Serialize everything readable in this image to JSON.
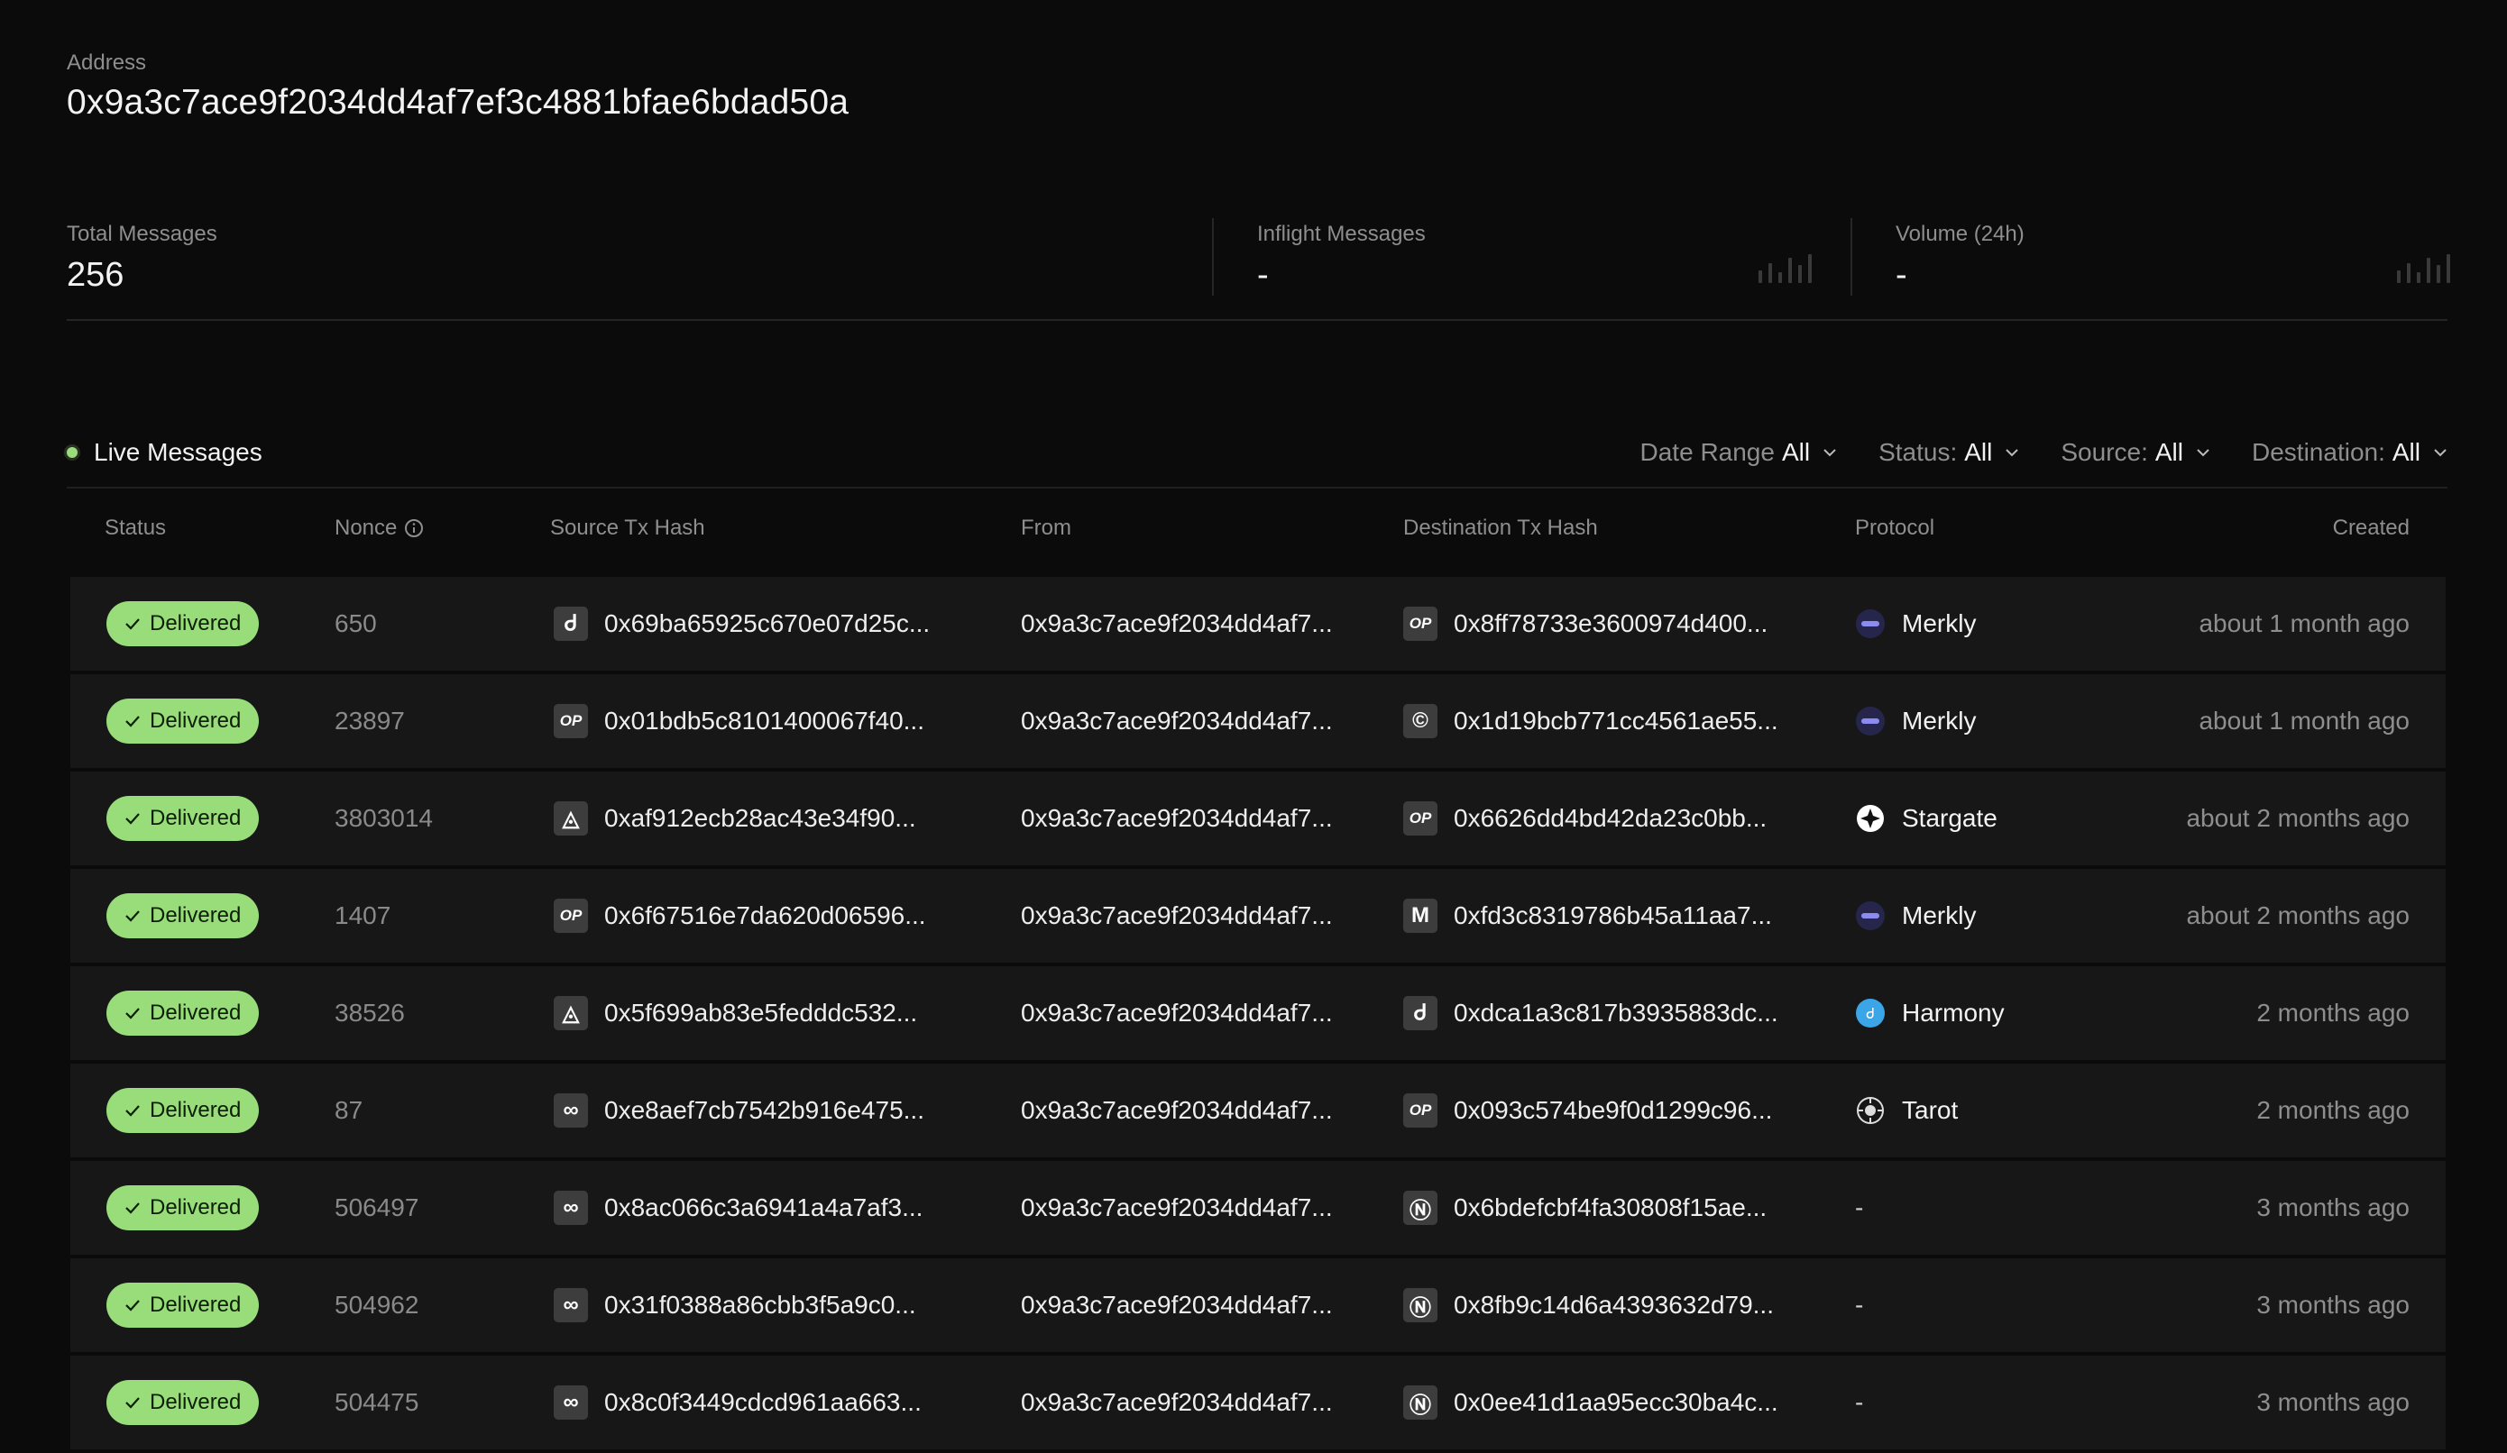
{
  "address": {
    "label": "Address",
    "value": "0x9a3c7ace9f2034dd4af7ef3c4881bfae6bdad50a"
  },
  "stats": [
    {
      "label": "Total Messages",
      "value": "256"
    },
    {
      "label": "Inflight Messages",
      "value": "-"
    },
    {
      "label": "Volume (24h)",
      "value": "-"
    }
  ],
  "live": {
    "label": "Live Messages",
    "dot_color": "#9ddc7d"
  },
  "filters": [
    {
      "label": "Date Range",
      "value": "All"
    },
    {
      "label": "Status:",
      "value": "All"
    },
    {
      "label": "Source:",
      "value": "All"
    },
    {
      "label": "Destination:",
      "value": "All"
    }
  ],
  "columns": {
    "status": "Status",
    "nonce": "Nonce",
    "source_tx": "Source Tx Hash",
    "from": "From",
    "dest_tx": "Destination Tx Hash",
    "protocol": "Protocol",
    "created": "Created"
  },
  "colors": {
    "delivered_badge": "#98dd7a",
    "background": "#0b0b0b",
    "row": "#171717"
  },
  "rows": [
    {
      "status": "Delivered",
      "nonce": "650",
      "src_icon": "harmony-chain-icon",
      "src_glyph": "Ꮷ",
      "source_tx": "0x69ba65925c670e07d25c...",
      "from": "0x9a3c7ace9f2034dd4af7...",
      "dst_icon": "optimism-chain-icon",
      "dst_glyph": "OP",
      "dest_tx": "0x8ff78733e3600974d400...",
      "protocol_icon": "merkly-icon",
      "protocol": "Merkly",
      "created": "about 1 month ago"
    },
    {
      "status": "Delivered",
      "nonce": "23897",
      "src_icon": "optimism-chain-icon",
      "src_glyph": "OP",
      "source_tx": "0x01bdb5c8101400067f40...",
      "from": "0x9a3c7ace9f2034dd4af7...",
      "dst_icon": "celo-chain-icon",
      "dst_glyph": "©",
      "dest_tx": "0x1d19bcb771cc4561ae55...",
      "protocol_icon": "merkly-icon",
      "protocol": "Merkly",
      "created": "about 1 month ago"
    },
    {
      "status": "Delivered",
      "nonce": "3803014",
      "src_icon": "arbitrum-chain-icon",
      "src_glyph": "◬",
      "source_tx": "0xaf912ecb28ac43e34f90...",
      "from": "0x9a3c7ace9f2034dd4af7...",
      "dst_icon": "optimism-chain-icon",
      "dst_glyph": "OP",
      "dest_tx": "0x6626dd4bd42da23c0bb...",
      "protocol_icon": "stargate-icon",
      "protocol": "Stargate",
      "created": "about 2 months ago"
    },
    {
      "status": "Delivered",
      "nonce": "1407",
      "src_icon": "optimism-chain-icon",
      "src_glyph": "OP",
      "source_tx": "0x6f67516e7da620d06596...",
      "from": "0x9a3c7ace9f2034dd4af7...",
      "dst_icon": "metis-chain-icon",
      "dst_glyph": "M",
      "dest_tx": "0xfd3c8319786b45a11aa7...",
      "protocol_icon": "merkly-icon",
      "protocol": "Merkly",
      "created": "about 2 months ago"
    },
    {
      "status": "Delivered",
      "nonce": "38526",
      "src_icon": "arbitrum-chain-icon",
      "src_glyph": "◬",
      "source_tx": "0x5f699ab83e5fedddc532...",
      "from": "0x9a3c7ace9f2034dd4af7...",
      "dst_icon": "harmony-chain-icon",
      "dst_glyph": "Ꮷ",
      "dest_tx": "0xdca1a3c817b3935883dc...",
      "protocol_icon": "harmony-icon",
      "protocol": "Harmony",
      "created": "2 months ago"
    },
    {
      "status": "Delivered",
      "nonce": "87",
      "src_icon": "polygon-chain-icon",
      "src_glyph": "∞",
      "source_tx": "0xe8aef7cb7542b916e475...",
      "from": "0x9a3c7ace9f2034dd4af7...",
      "dst_icon": "optimism-chain-icon",
      "dst_glyph": "OP",
      "dest_tx": "0x093c574be9f0d1299c96...",
      "protocol_icon": "tarot-icon",
      "protocol": "Tarot",
      "created": "2 months ago"
    },
    {
      "status": "Delivered",
      "nonce": "506497",
      "src_icon": "polygon-chain-icon",
      "src_glyph": "∞",
      "source_tx": "0x8ac066c3a6941a4a7af3...",
      "from": "0x9a3c7ace9f2034dd4af7...",
      "dst_icon": "nova-chain-icon",
      "dst_glyph": "Ⓝ",
      "dest_tx": "0x6bdefcbf4fa30808f15ae...",
      "protocol_icon": "",
      "protocol": "-",
      "created": "3 months ago"
    },
    {
      "status": "Delivered",
      "nonce": "504962",
      "src_icon": "polygon-chain-icon",
      "src_glyph": "∞",
      "source_tx": "0x31f0388a86cbb3f5a9c0...",
      "from": "0x9a3c7ace9f2034dd4af7...",
      "dst_icon": "nova-chain-icon",
      "dst_glyph": "Ⓝ",
      "dest_tx": "0x8fb9c14d6a4393632d79...",
      "protocol_icon": "",
      "protocol": "-",
      "created": "3 months ago"
    },
    {
      "status": "Delivered",
      "nonce": "504475",
      "src_icon": "polygon-chain-icon",
      "src_glyph": "∞",
      "source_tx": "0x8c0f3449cdcd961aa663...",
      "from": "0x9a3c7ace9f2034dd4af7...",
      "dst_icon": "nova-chain-icon",
      "dst_glyph": "Ⓝ",
      "dest_tx": "0x0ee41d1aa95ecc30ba4c...",
      "protocol_icon": "",
      "protocol": "-",
      "created": "3 months ago"
    }
  ]
}
